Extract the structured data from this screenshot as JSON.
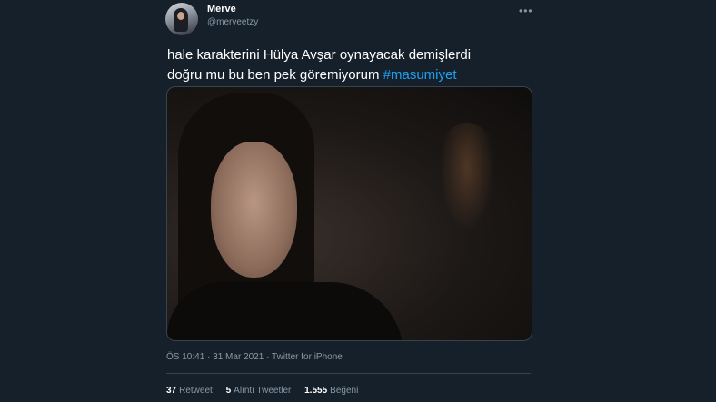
{
  "author": {
    "name": "Merve",
    "handle": "@merveetzy",
    "avatar_icon": "profile-photo-avatar"
  },
  "more_icon": "more-options-icon",
  "more_glyph": "•••",
  "tweet": {
    "line1": "hale karakterini Hülya Avşar oynayacak demişlerdi",
    "line2": "doğru mu bu ben pek göremiyorum ",
    "hashtag": "#masumiyet"
  },
  "media": {
    "type": "video-still"
  },
  "meta": {
    "time": "ÖS 10:41",
    "sep1": " · ",
    "date": "31 Mar 2021",
    "sep2": " · ",
    "source": "Twitter for iPhone"
  },
  "stats": {
    "retweets_count": "37",
    "retweets_label": "Retweet",
    "quotes_count": "5",
    "quotes_label": "Alıntı Tweetler",
    "likes_count": "1.555",
    "likes_label": "Beğeni"
  },
  "colors": {
    "background": "#15202b",
    "accent": "#1da1f2",
    "secondary_text": "#8899a6",
    "divider": "#38444d"
  }
}
